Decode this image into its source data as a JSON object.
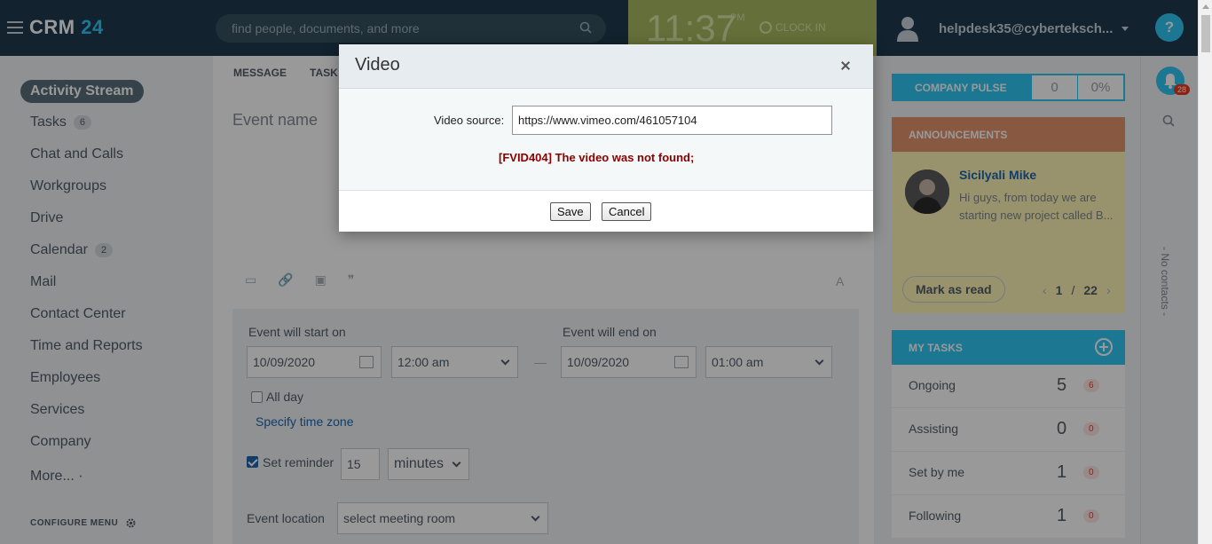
{
  "header": {
    "logo_main": "CRM",
    "logo_num": "24",
    "search_placeholder": "find people, documents, and more",
    "clock": {
      "time": "11:37",
      "ampm": "PM",
      "clock_in": "CLOCK IN"
    },
    "user_email": "helpdesk35@cyberteksch...",
    "help": "?"
  },
  "sidebar": {
    "items": [
      {
        "label": "Activity Stream",
        "count": ""
      },
      {
        "label": "Tasks",
        "count": "6"
      },
      {
        "label": "Chat and Calls",
        "count": ""
      },
      {
        "label": "Workgroups",
        "count": ""
      },
      {
        "label": "Drive",
        "count": ""
      },
      {
        "label": "Calendar",
        "count": "2"
      },
      {
        "label": "Mail",
        "count": ""
      },
      {
        "label": "Contact Center",
        "count": ""
      },
      {
        "label": "Time and Reports",
        "count": ""
      },
      {
        "label": "Employees",
        "count": ""
      },
      {
        "label": "Services",
        "count": ""
      },
      {
        "label": "Company",
        "count": ""
      },
      {
        "label": "More... ·",
        "count": ""
      }
    ],
    "configure": "CONFIGURE MENU"
  },
  "feed": {
    "tabs": [
      "MESSAGE",
      "TASK"
    ],
    "event_name_placeholder": "Event name",
    "start_label": "Event will start on",
    "end_label": "Event will end on",
    "start_date": "10/09/2020",
    "start_time": "12:00 am",
    "end_date": "10/09/2020",
    "end_time": "01:00 am",
    "dash": "—",
    "all_day": "All day",
    "specify_tz": "Specify time zone",
    "set_reminder": "Set reminder",
    "reminder_value": "15",
    "reminder_unit": "minutes",
    "location_label": "Event location",
    "location_value": "select meeting room",
    "text_icon": "A"
  },
  "right": {
    "pulse_title": "COMPANY PULSE",
    "pulse_value": "0",
    "pulse_percent": "0%",
    "announcements_title": "ANNOUNCEMENTS",
    "ann_author": "Sicilyali Mike",
    "ann_text": "Hi guys, from today we are starting new project called B...",
    "mark_read": "Mark as read",
    "pager_current": "1",
    "pager_sep": "/",
    "pager_total": "22",
    "tasks_title": "MY TASKS",
    "tasks": [
      {
        "label": "Ongoing",
        "count": "5",
        "badge": "6"
      },
      {
        "label": "Assisting",
        "count": "0",
        "badge": "0"
      },
      {
        "label": "Set by me",
        "count": "1",
        "badge": "0"
      },
      {
        "label": "Following",
        "count": "1",
        "badge": "0"
      }
    ]
  },
  "farright": {
    "notif_count": "28",
    "no_contacts": "- No contacts -"
  },
  "modal": {
    "title": "Video",
    "video_source_label": "Video source:",
    "video_source_value": "https://www.vimeo.com/461057104",
    "error": "[FVID404] The video was not found;",
    "save": "Save",
    "cancel": "Cancel"
  },
  "colors": {
    "accent": "#2fc6f6",
    "topbar": "#1f3a4d",
    "clock_bg": "#a8b95f",
    "announcement_head": "#e3946c",
    "error": "#8a0000"
  }
}
